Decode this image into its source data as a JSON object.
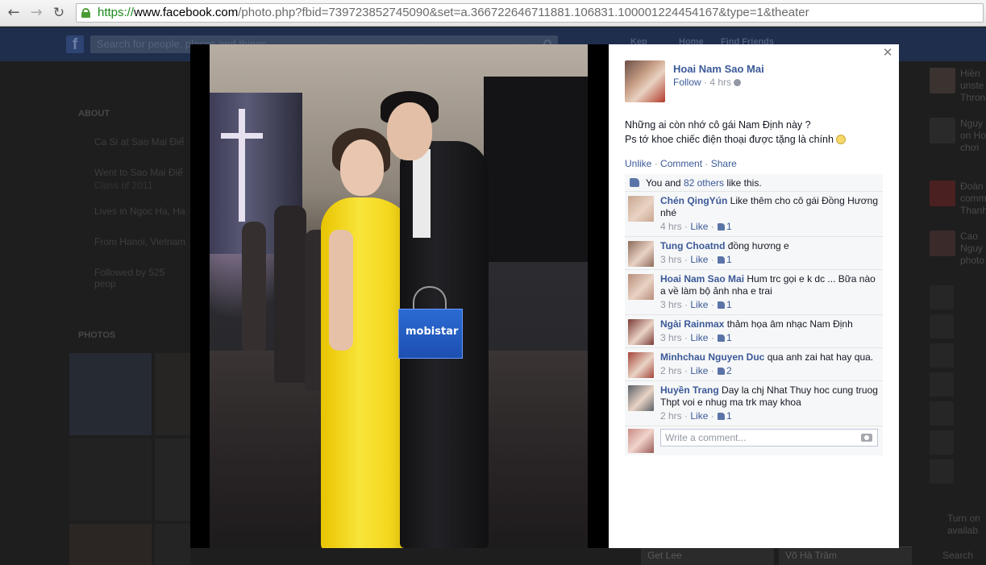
{
  "browser": {
    "url_scheme": "https://",
    "url_host": "www.facebook.com",
    "url_rest": "/photo.php?fbid=739723852745090&set=a.366722646711881.106831.100001224454167&type=1&theater"
  },
  "fb": {
    "search_placeholder": "Search for people, places and things",
    "nav": [
      "Kep",
      "Home",
      "Find Friends"
    ]
  },
  "bg_left": {
    "about": "ABOUT",
    "rows": [
      {
        "text": "Ca Si at Sao Mai Điể",
        "sub": ""
      },
      {
        "text": "Went to Sao Mai Điể",
        "sub": "Class of 2011"
      },
      {
        "text": "Lives in Ngoc Ha, Ha",
        "sub": ""
      },
      {
        "text": "From Hanoi, Vietnam",
        "sub": ""
      },
      {
        "text": "Followed by 525 peop",
        "sub": ""
      }
    ],
    "photos": "PHOTOS"
  },
  "bg_right": [
    {
      "line1": "Hiền",
      "line2": "unste",
      "line3": "Thron"
    },
    {
      "line1": "Nguy",
      "line2": "on Ho",
      "line3": "chơi"
    },
    {
      "line1": "Đoàn",
      "line2": "comm",
      "line3": "Thanh"
    },
    {
      "line1": "Cao",
      "line2": "Nguy",
      "line3": "photo"
    }
  ],
  "bg_chat": {
    "line1": "Turn on",
    "line2": "availab",
    "search": "Search"
  },
  "bg_bottom_tabs": [
    "Get Lee",
    "Võ Hà Trâm"
  ],
  "photo": {
    "bag_text": "mobistar"
  },
  "panel": {
    "author": "Hoai Nam Sao Mai",
    "follow": "Follow",
    "sep": " · ",
    "time": "4 hrs",
    "post_line1": "Những ai còn nhớ cô gái Nam Định này ?",
    "post_line2": "Ps tớ khoe chiếc điện thoại được tặng là chính",
    "actions": {
      "unlike": "Unlike",
      "comment": "Comment",
      "share": "Share",
      "sep": " · "
    },
    "likes": {
      "prefix": "You and ",
      "link": "82 others",
      "suffix": " like this."
    },
    "comments": [
      {
        "name": "Chén QingYún",
        "text": "Like thêm cho cô gái Đồng Hương nhé",
        "time": "4 hrs",
        "like": "Like",
        "count": "1",
        "avatar_color": "#c9a78f"
      },
      {
        "name": "Tung Choatnd",
        "text": "đồng hương e",
        "time": "3 hrs",
        "like": "Like",
        "count": "1",
        "avatar_color": "#8c6a5a"
      },
      {
        "name": "Hoai Nam Sao Mai",
        "text": "Hum trc gọi e k dc ... Bữa nào a về làm bộ ảnh nha e trai",
        "time": "3 hrs",
        "like": "Like",
        "count": "1",
        "avatar_color": "#b98d7a"
      },
      {
        "name": "Ngài Rainmax",
        "text": "thảm họa âm nhạc Nam Định",
        "time": "3 hrs",
        "like": "Like",
        "count": "1",
        "avatar_color": "#7a3a34"
      },
      {
        "name": "Minhchau Nguyen Duc",
        "text": "qua anh zai hat hay qua.",
        "time": "2 hrs",
        "like": "Like",
        "count": "2",
        "avatar_color": "#a5443a"
      },
      {
        "name": "Huyền Trang",
        "text": "Day la chj Nhat Thuy hoc cung truog Thpt voi e nhug ma trk may khoa",
        "time": "2 hrs",
        "like": "Like",
        "count": "1",
        "avatar_color": "#5a5f66"
      }
    ],
    "write_placeholder": "Write a comment..."
  }
}
